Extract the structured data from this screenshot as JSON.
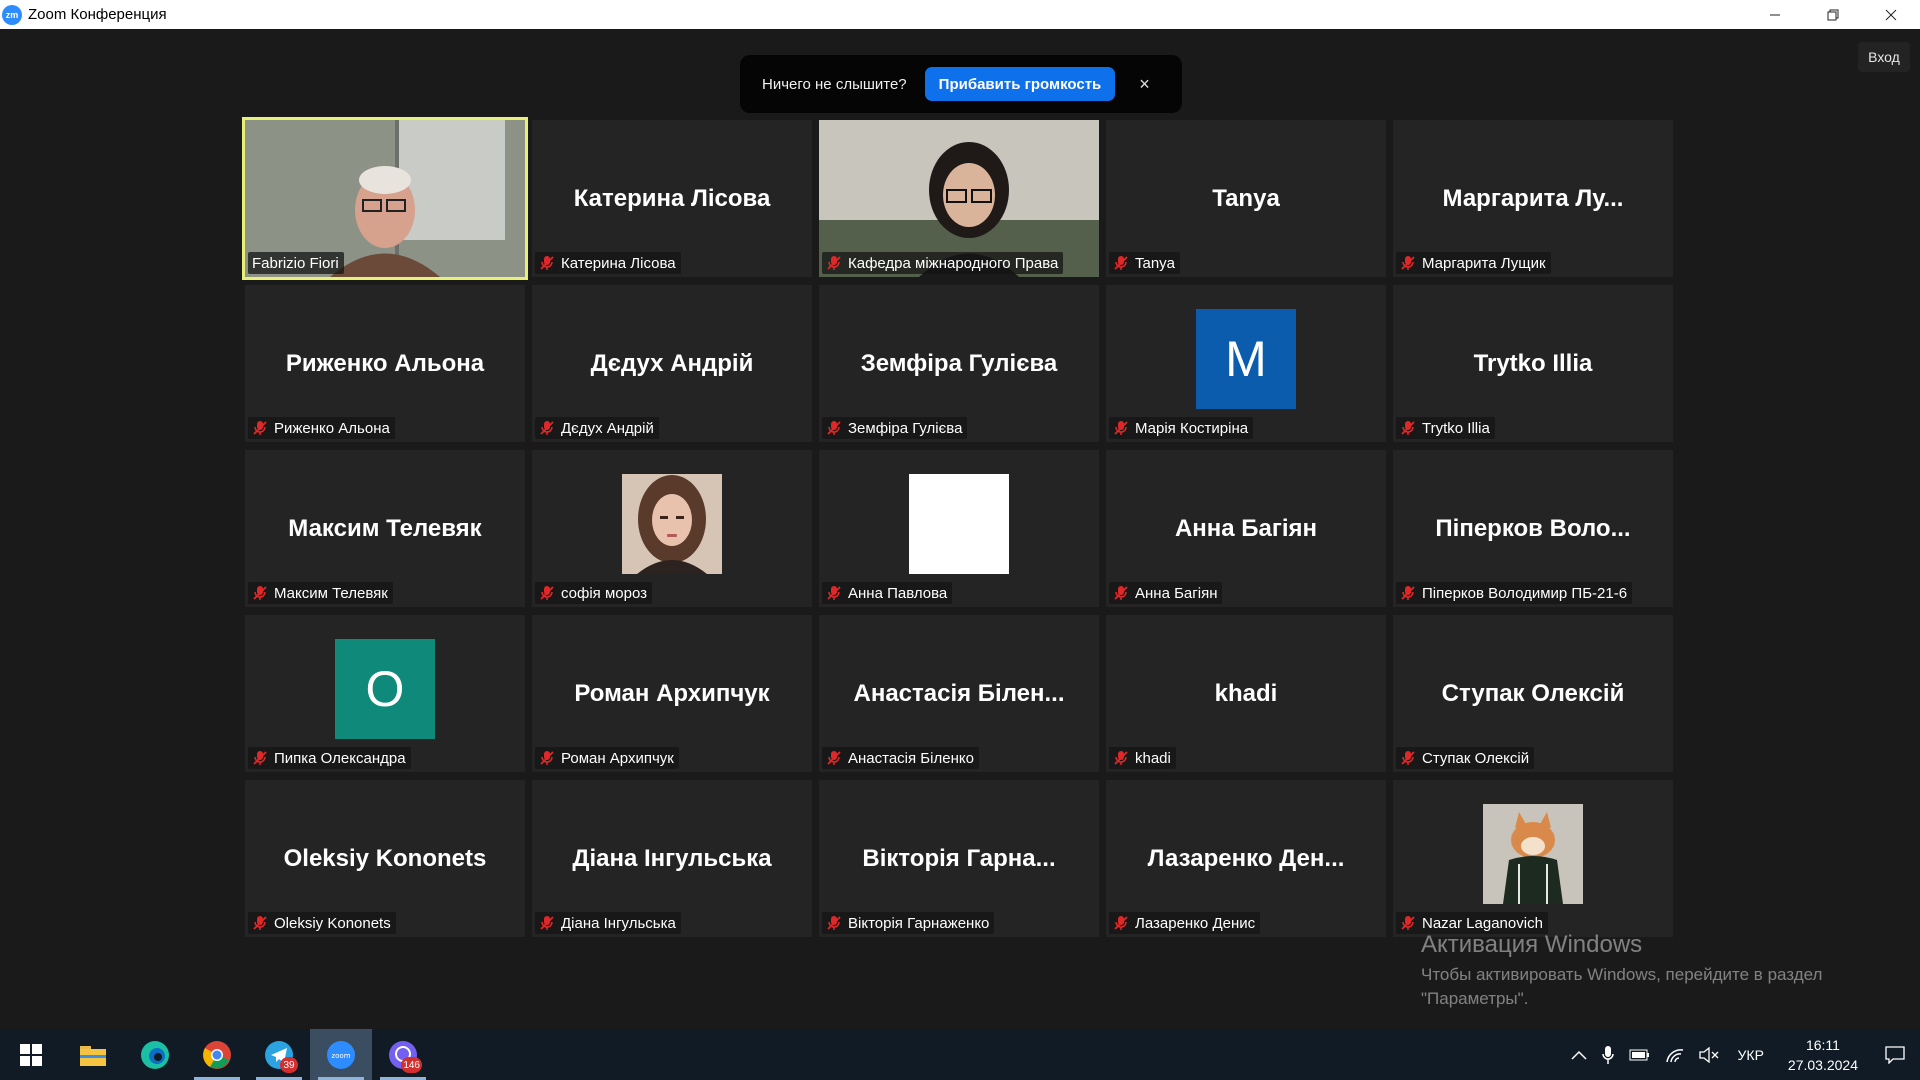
{
  "window": {
    "title": "Zoom Конференция",
    "logo": "zm"
  },
  "login_label": "Вход",
  "notice": {
    "text": "Ничего не слышите?",
    "button": "Прибавить громкость",
    "close": "×"
  },
  "tiles": [
    {
      "label": "Fabrizio Fiori",
      "display": "",
      "muted": false,
      "kind": "video-man",
      "active": true
    },
    {
      "label": "Катерина Лісова",
      "display": "Катерина Лісова",
      "muted": true,
      "kind": "name"
    },
    {
      "label": "Кафедра міжнародного Права",
      "display": "",
      "muted": true,
      "kind": "video-woman"
    },
    {
      "label": "Tanya",
      "display": "Tanya",
      "muted": true,
      "kind": "name"
    },
    {
      "label": "Маргарита Лущик",
      "display": "Маргарита Лу...",
      "muted": true,
      "kind": "name"
    },
    {
      "label": "Риженко Альона",
      "display": "Риженко Альона",
      "muted": true,
      "kind": "name"
    },
    {
      "label": "Дєдух Андрій",
      "display": "Дєдух Андрій",
      "muted": true,
      "kind": "name"
    },
    {
      "label": "Земфіра Гулієва",
      "display": "Земфіра Гулієва",
      "muted": true,
      "kind": "name"
    },
    {
      "label": "Марія Костиріна",
      "display": "M",
      "muted": true,
      "kind": "letter",
      "avatar_color": "#0b5cad"
    },
    {
      "label": "Trytko Illia",
      "display": "Trytko Illia",
      "muted": true,
      "kind": "name"
    },
    {
      "label": "Максим Телевяк",
      "display": "Максим Телевяк",
      "muted": true,
      "kind": "name"
    },
    {
      "label": "софія мороз",
      "display": "",
      "muted": true,
      "kind": "photo-girl"
    },
    {
      "label": "Анна Павлова",
      "display": "",
      "muted": true,
      "kind": "photo-white"
    },
    {
      "label": "Анна Багіян",
      "display": "Анна Багіян",
      "muted": true,
      "kind": "name"
    },
    {
      "label": "Піперков Володимир ПБ-21-6",
      "display": "Піперков Воло...",
      "muted": true,
      "kind": "name"
    },
    {
      "label": "Пипка Олександра",
      "display": "O",
      "muted": true,
      "kind": "letter",
      "avatar_color": "#0f8a7a"
    },
    {
      "label": "Роман Архипчук",
      "display": "Роман Архипчук",
      "muted": true,
      "kind": "name"
    },
    {
      "label": "Анастасія Біленко",
      "display": "Анастасія Білен...",
      "muted": true,
      "kind": "name"
    },
    {
      "label": "khadi",
      "display": "khadi",
      "muted": true,
      "kind": "name"
    },
    {
      "label": "Ступак Олексій",
      "display": "Ступак Олексій",
      "muted": true,
      "kind": "name"
    },
    {
      "label": "Oleksiy Kononets",
      "display": "Oleksiy Kononets",
      "muted": true,
      "kind": "name"
    },
    {
      "label": "Діана Інгульська",
      "display": "Діана Інгульська",
      "muted": true,
      "kind": "name"
    },
    {
      "label": "Вікторія Гарнаженко",
      "display": "Вікторія Гарна...",
      "muted": true,
      "kind": "name"
    },
    {
      "label": "Лазаренко Денис",
      "display": "Лазаренко Ден...",
      "muted": true,
      "kind": "name"
    },
    {
      "label": "Nazar Laganovich",
      "display": "",
      "muted": true,
      "kind": "photo-dog"
    }
  ],
  "watermark": {
    "title": "Активация Windows",
    "text": "Чтобы активировать Windows, перейдите в раздел \"Параметры\"."
  },
  "taskbar": {
    "apps": [
      {
        "name": "start-icon"
      },
      {
        "name": "file-explorer-icon"
      },
      {
        "name": "edge-icon"
      },
      {
        "name": "chrome-icon"
      },
      {
        "name": "telegram-icon",
        "badge": "39"
      },
      {
        "name": "zoom-icon",
        "active": true
      },
      {
        "name": "viber-icon",
        "badge": "146"
      }
    ],
    "language": "УКР",
    "time": "16:11",
    "date": "27.03.2024"
  },
  "colors": {
    "active_speaker": "#e8f07a",
    "accent": "#0e71eb",
    "muted_mic": "#e02828"
  }
}
